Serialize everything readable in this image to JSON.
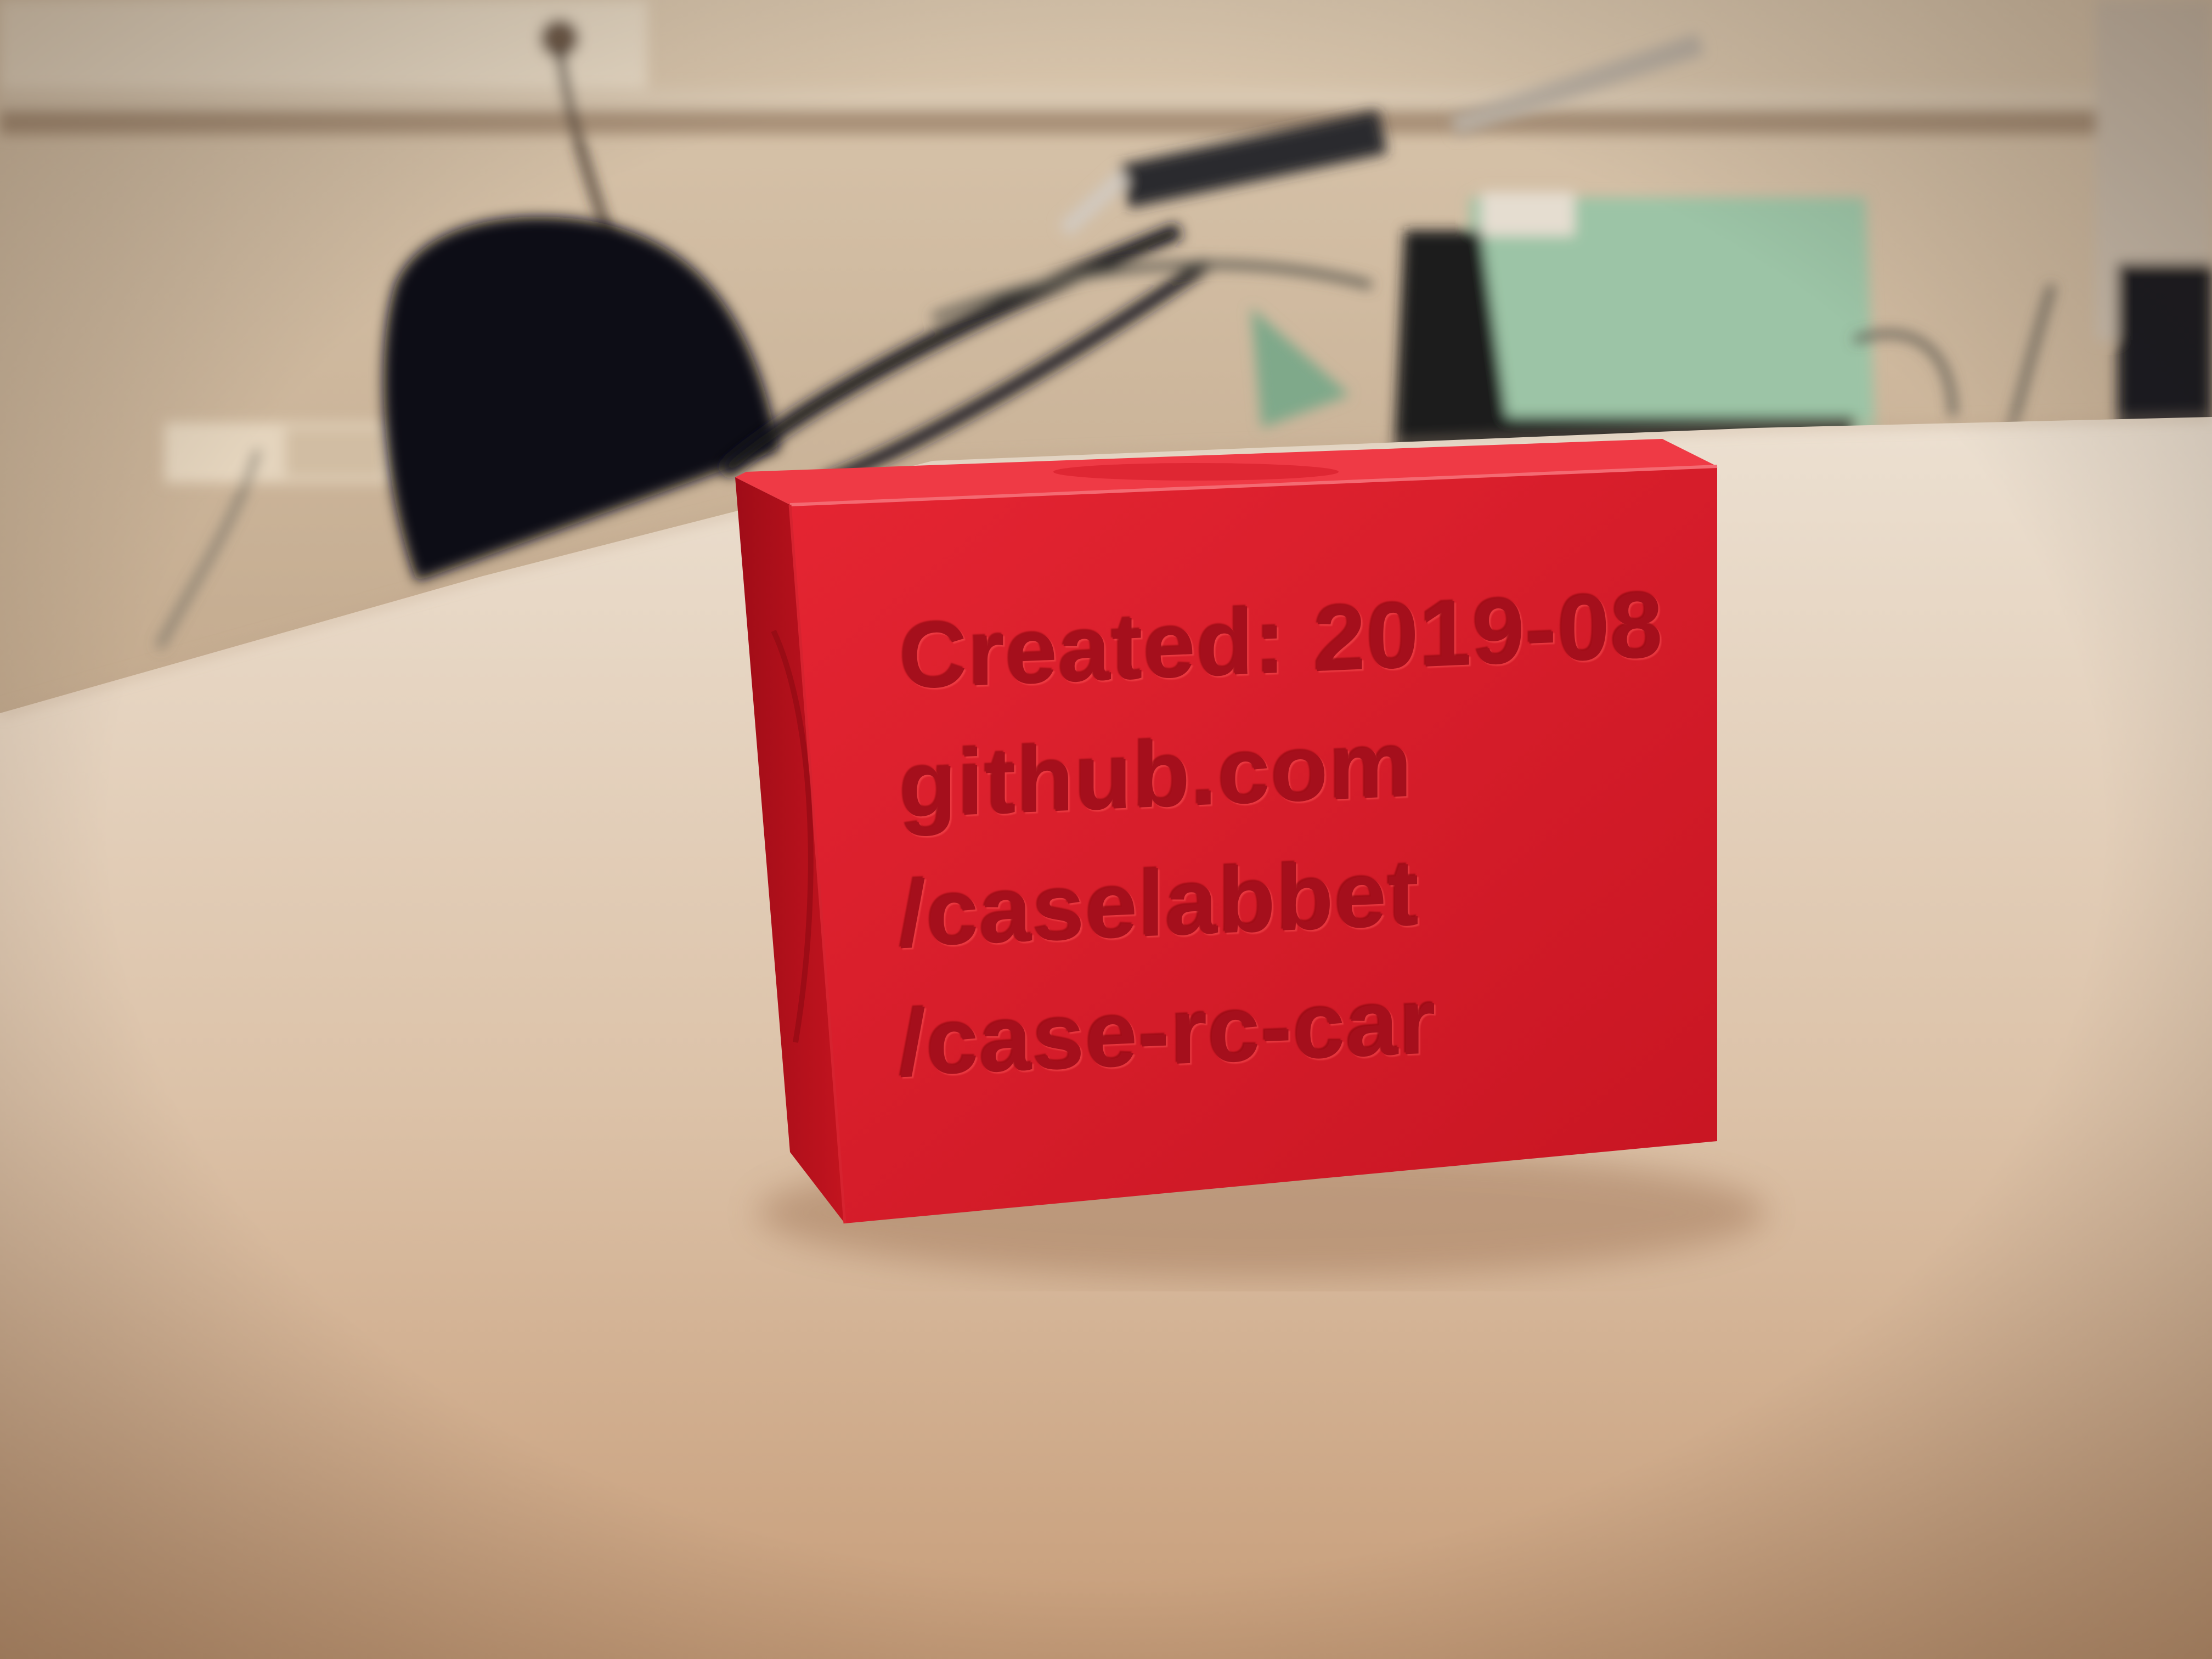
{
  "photo": {
    "colors": {
      "wall": "#d3bfa5",
      "shelf": "#e2d3bd",
      "desk_top": "#e7d7c6",
      "desk_near": "#caa684",
      "chair": "#0d0f12",
      "block_front": "#e01c29",
      "block_top": "#ef3a45",
      "block_side": "#b8121d",
      "engraving": "#a50f1c",
      "station_green": "#9cc4a6",
      "station_black": "#1a1b1d",
      "cable": "#16191b"
    }
  },
  "block": {
    "engraving_lines": [
      "Created: 2019-08",
      "github.com",
      "/caselabbet",
      "/case-rc-car"
    ]
  }
}
